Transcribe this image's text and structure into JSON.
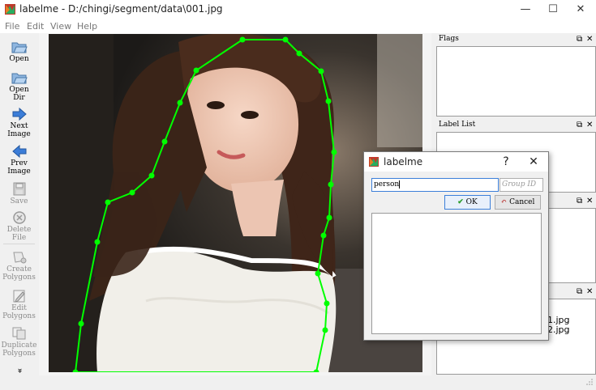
{
  "window": {
    "title": "labelme - D:/chingi/segment/data\\001.jpg",
    "minimize": "—",
    "maximize": "☐",
    "close": "✕"
  },
  "menu": [
    "File",
    "Edit",
    "View",
    "Help"
  ],
  "tools": [
    {
      "label": "Open",
      "icon": "folder-open-icon",
      "enabled": true
    },
    {
      "label": "Open Dir",
      "icon": "folder-open-icon",
      "enabled": true
    },
    {
      "label": "Next Image",
      "icon": "arrow-right-icon",
      "enabled": true
    },
    {
      "label": "Prev Image",
      "icon": "arrow-left-icon",
      "enabled": true
    },
    {
      "label": "Save",
      "icon": "save-icon",
      "enabled": false
    },
    {
      "label": "Delete File",
      "icon": "delete-icon",
      "enabled": false
    },
    {
      "label": "Create Polygons",
      "icon": "create-polygon-icon",
      "enabled": false
    },
    {
      "label": "Edit Polygons",
      "icon": "edit-icon",
      "enabled": false
    },
    {
      "label": "Duplicate Polygons",
      "icon": "duplicate-icon",
      "enabled": false
    },
    {
      "label": "»",
      "icon": "more-icon",
      "enabled": true
    }
  ],
  "docks": {
    "flags": {
      "title": "Flags"
    },
    "label_list": {
      "title": "Label List"
    },
    "float_glyph": "⧉",
    "close_glyph": "✕"
  },
  "file_list": [
    "1.jpg",
    "2.jpg"
  ],
  "dialog": {
    "title": "labelme",
    "help": "?",
    "close": "✕",
    "label_value": "person",
    "group_id_placeholder": "Group ID",
    "ok": "OK",
    "cancel": "Cancel"
  },
  "colors": {
    "polygon": "#00ff00",
    "accent": "#3c7fd9"
  }
}
